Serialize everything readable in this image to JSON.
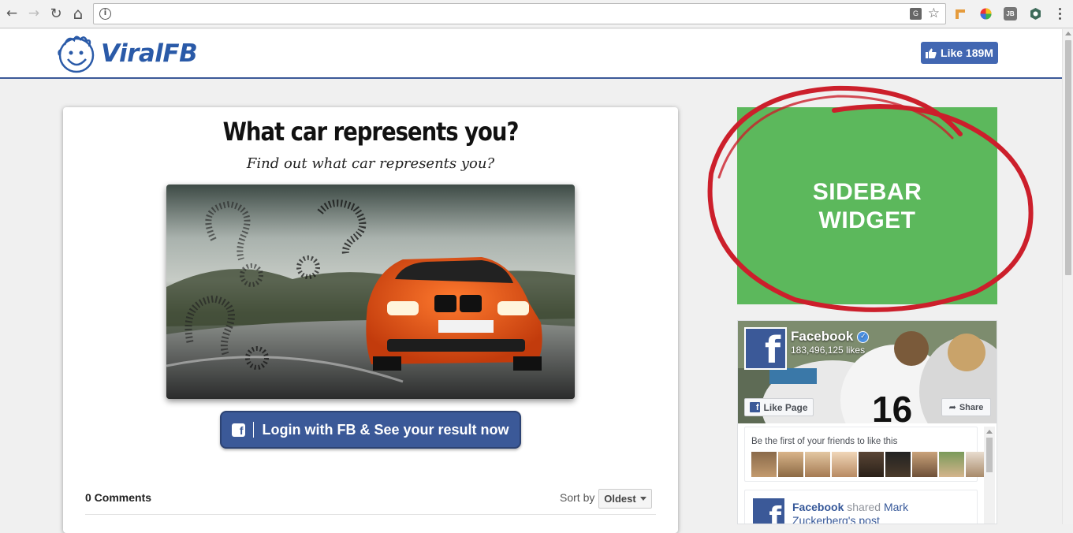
{
  "browser": {
    "back_glyph": "←",
    "forward_glyph": "→",
    "reload_glyph": "↻",
    "home_glyph": "⌂",
    "address_value": "",
    "info_glyph": "i",
    "star_glyph": "☆",
    "extension_labels": [
      "JB"
    ]
  },
  "site": {
    "logo_text": "ViralFB",
    "like_button_label": "Like 189M"
  },
  "quiz": {
    "title": "What car represents you?",
    "subtitle": "Find out what car represents you?",
    "login_button_label": "Login with FB & See your result now",
    "fb_icon_letter": "f"
  },
  "comments": {
    "count_label": "0 Comments",
    "sort_label": "Sort by",
    "sort_value": "Oldest"
  },
  "sidebar_widget": {
    "line1": "SIDEBAR",
    "line2": "WIDGET"
  },
  "fb_page": {
    "name": "Facebook",
    "likes": "183,496,125 likes",
    "like_page_label": "Like Page",
    "share_label": "Share",
    "friends_text": "Be the first of your friends to like this",
    "post_author": "Facebook",
    "post_action": "shared",
    "post_target": "Mark Zuckerberg's post",
    "icon_letter": "f"
  },
  "colors": {
    "fb_blue": "#3b5998",
    "widget_green": "#5cb85c",
    "circle_red": "#cc1f2b"
  }
}
